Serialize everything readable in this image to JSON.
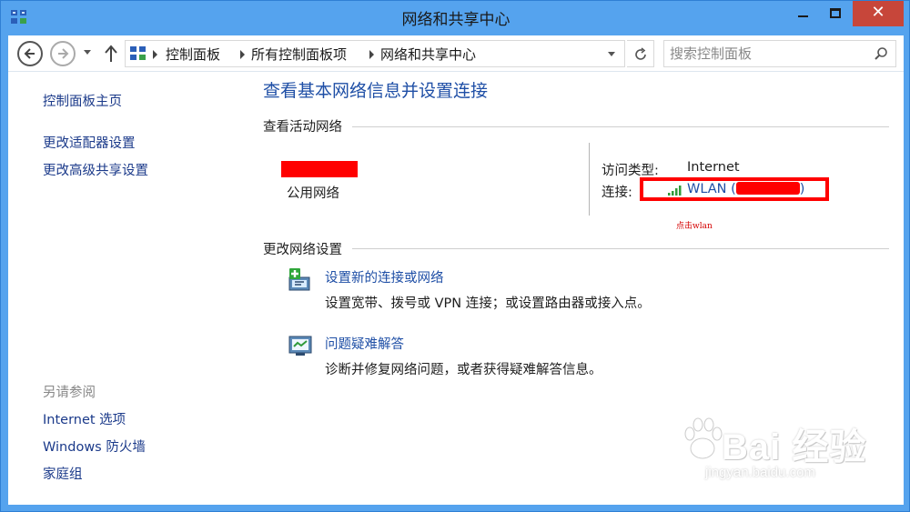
{
  "window": {
    "title": "网络和共享中心"
  },
  "address": {
    "crumbs": [
      "控制面板",
      "所有控制面板项",
      "网络和共享中心"
    ],
    "search_placeholder": "搜索控制面板"
  },
  "sidebar": {
    "home": "控制面板主页",
    "items": [
      "更改适配器设置",
      "更改高级共享设置"
    ],
    "see_also_heading": "另请参阅",
    "see_also": [
      "Internet 选项",
      "Windows 防火墙",
      "家庭组"
    ]
  },
  "main": {
    "title": "查看基本网络信息并设置连接",
    "active_section": "查看活动网络",
    "network_type": "公用网络",
    "access_type_label": "访问类型:",
    "access_type_value": "Internet",
    "connections_label": "连接:",
    "connection_link": "WLAN (",
    "connection_link_end": ")",
    "annotation": "点击wlan",
    "change_section": "更改网络设置",
    "tasks": [
      {
        "title": "设置新的连接或网络",
        "desc": "设置宽带、拨号或 VPN 连接；或设置路由器或接入点。"
      },
      {
        "title": "问题疑难解答",
        "desc": "诊断并修复网络问题，或者获得疑难解答信息。"
      }
    ]
  },
  "watermark": {
    "brand": "Bai  经验",
    "url": "jingyan.baidu.com"
  },
  "colors": {
    "link": "#1f4fa6",
    "titlebar": "#55a3ee",
    "close": "#c7463a",
    "redaction": "#ff0000"
  }
}
